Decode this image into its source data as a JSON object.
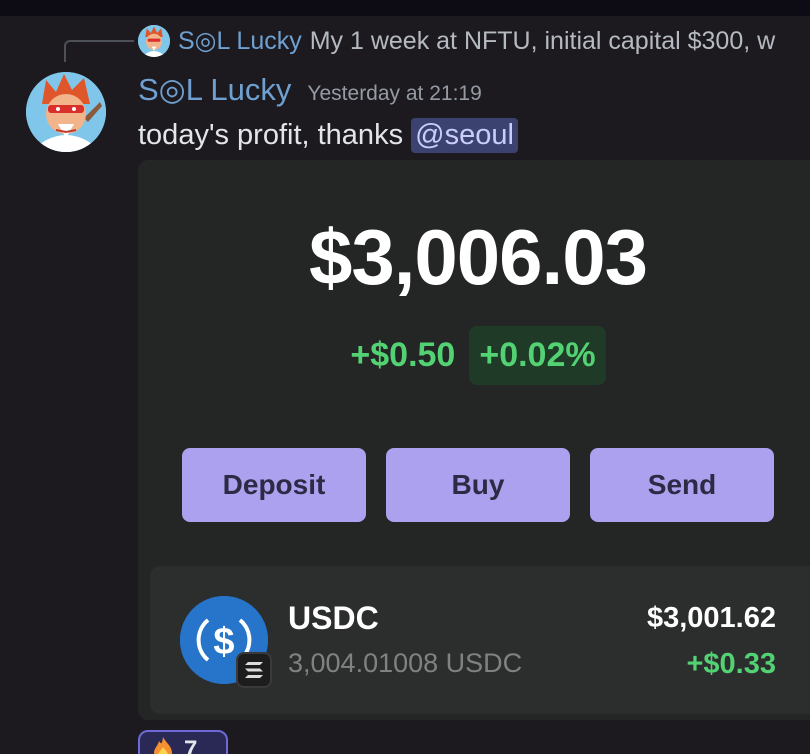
{
  "reply": {
    "author": "S◎L Lucky",
    "text": "My 1 week at NFTU, initial capital $300, w"
  },
  "message": {
    "author": "S◎L Lucky",
    "timestamp": "Yesterday at 21:19",
    "text": "today's profit, thanks ",
    "mention": "@seoul"
  },
  "wallet": {
    "balance": "$3,006.03",
    "change_abs": "+$0.50",
    "change_pct": "+0.02%",
    "actions": [
      "Deposit",
      "Buy",
      "Send"
    ],
    "asset": {
      "name": "USDC",
      "amount": "3,004.01008 USDC",
      "value": "$3,001.62",
      "change": "+$0.33",
      "icon": "usdc-icon",
      "chain_icon": "solana-icon"
    }
  },
  "reaction": {
    "emoji": "fire-icon",
    "count": "7"
  },
  "colors": {
    "background": "#1c1a1f",
    "author": "#6fa0d0",
    "mention_bg": "#3c4270",
    "card_bg": "#242525",
    "button_bg": "#aba1ee",
    "positive": "#52d273",
    "usdc_blue": "#2775ca"
  }
}
